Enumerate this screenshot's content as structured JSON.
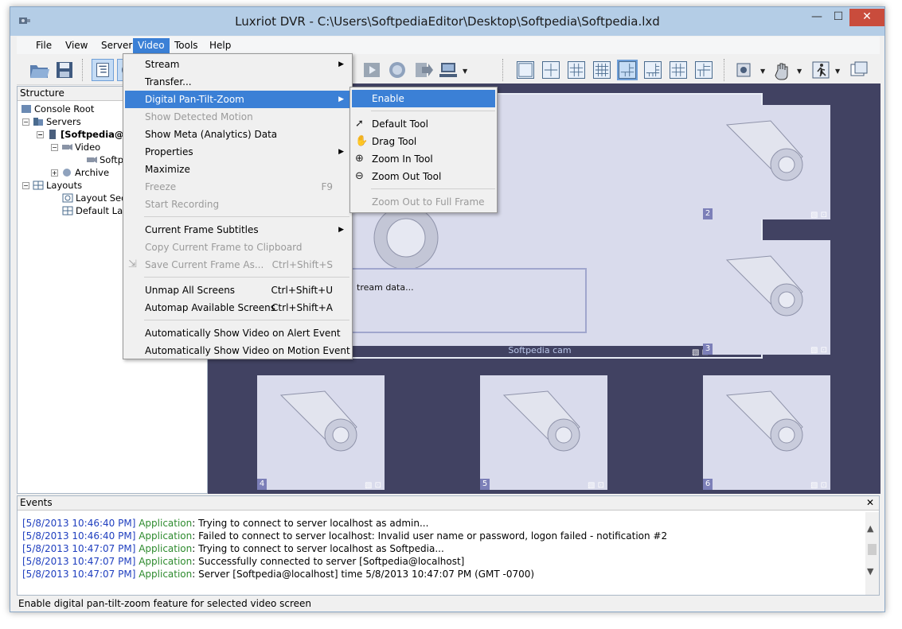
{
  "window": {
    "title": "Luxriot DVR - C:\\Users\\SoftpediaEditor\\Desktop\\Softpedia\\Softpedia.lxd",
    "min_glyph": "—",
    "max_glyph": "☐",
    "close_glyph": "✕"
  },
  "menubar": {
    "items": [
      {
        "label": "File"
      },
      {
        "label": "View"
      },
      {
        "label": "Server"
      },
      {
        "label": "Video"
      },
      {
        "label": "Tools"
      },
      {
        "label": "Help"
      }
    ]
  },
  "structure": {
    "header": "Structure",
    "items": [
      {
        "label": "Console Root"
      },
      {
        "label": "Servers"
      },
      {
        "label": "[Softpedia@"
      },
      {
        "label": "Video"
      },
      {
        "label": "Softpe"
      },
      {
        "label": "Archive"
      },
      {
        "label": "Layouts"
      },
      {
        "label": "Layout Sequer"
      },
      {
        "label": "Default Layout"
      }
    ]
  },
  "video_menu": {
    "items": [
      {
        "label": "Stream",
        "shortcut": ""
      },
      {
        "label": "Transfer...",
        "shortcut": ""
      },
      {
        "label": "Digital Pan-Tilt-Zoom",
        "shortcut": ""
      },
      {
        "label": "Show Detected Motion",
        "shortcut": ""
      },
      {
        "label": "Show Meta (Analytics) Data",
        "shortcut": ""
      },
      {
        "label": "Properties",
        "shortcut": ""
      },
      {
        "label": "Maximize",
        "shortcut": ""
      },
      {
        "label": "Freeze",
        "shortcut": "F9"
      },
      {
        "label": "Start Recording",
        "shortcut": ""
      },
      {
        "label": "Current Frame Subtitles",
        "shortcut": ""
      },
      {
        "label": "Copy Current Frame to Clipboard",
        "shortcut": ""
      },
      {
        "label": "Save Current Frame As...",
        "shortcut": "Ctrl+Shift+S"
      },
      {
        "label": "Unmap All Screens",
        "shortcut": "Ctrl+Shift+U"
      },
      {
        "label": "Automap Available Screens",
        "shortcut": "Ctrl+Shift+A"
      },
      {
        "label": "Automatically Show Video on Alert Event",
        "shortcut": ""
      },
      {
        "label": "Automatically Show Video on Motion Event",
        "shortcut": ""
      }
    ]
  },
  "ptz_submenu": {
    "items": [
      {
        "label": "Enable"
      },
      {
        "label": "Default Tool"
      },
      {
        "label": "Drag Tool"
      },
      {
        "label": "Zoom In Tool"
      },
      {
        "label": "Zoom Out Tool"
      },
      {
        "label": "Zoom Out to Full Frame"
      }
    ]
  },
  "view": {
    "main_caption": "Softpedia cam",
    "stream_text": "tream data...",
    "screens": [
      {
        "number": "2"
      },
      {
        "number": "3"
      },
      {
        "number": "4"
      },
      {
        "number": "5"
      },
      {
        "number": "6"
      }
    ]
  },
  "events": {
    "header": "Events",
    "close_glyph": "✕",
    "lines": [
      {
        "time": "[5/8/2013 10:46:40 PM]",
        "source": "Application",
        "message": ": Trying to connect to server localhost as admin..."
      },
      {
        "time": "[5/8/2013 10:46:40 PM]",
        "source": "Application",
        "message": ": Failed to connect to server localhost: Invalid user name or password, logon failed - notification #2"
      },
      {
        "time": "[5/8/2013 10:47:07 PM]",
        "source": "Application",
        "message": ": Trying to connect to server localhost as Softpedia..."
      },
      {
        "time": "[5/8/2013 10:47:07 PM]",
        "source": "Application",
        "message": ": Successfully connected to server [Softpedia@localhost]"
      },
      {
        "time": "[5/8/2013 10:47:07 PM]",
        "source": "Application",
        "message": ": Server [Softpedia@localhost] time 5/8/2013 10:47:07 PM (GMT -0700)"
      }
    ]
  },
  "statusbar": {
    "text": "Enable digital pan-tilt-zoom feature for selected video screen"
  }
}
